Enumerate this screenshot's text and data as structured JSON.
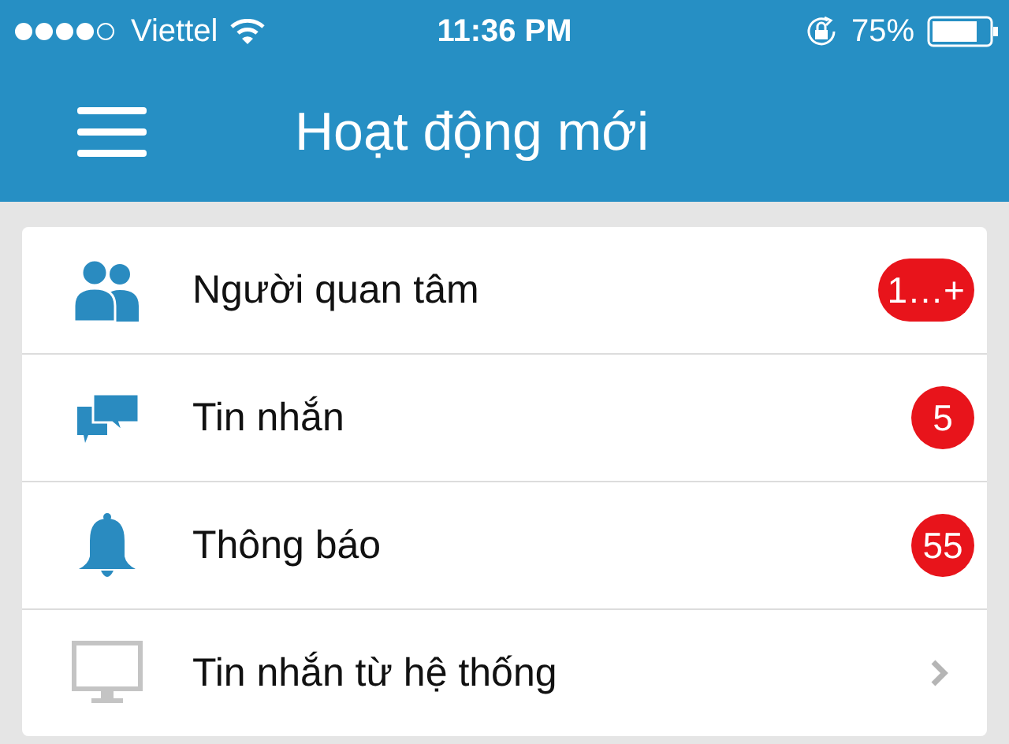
{
  "status_bar": {
    "carrier": "Viettel",
    "time": "11:36 PM",
    "battery": "75%"
  },
  "header": {
    "title": "Hoạt động mới"
  },
  "items": [
    {
      "label": "Người quan tâm",
      "kind": "badge",
      "badge": "1…+"
    },
    {
      "label": "Tin nhắn",
      "kind": "badge",
      "badge": "5"
    },
    {
      "label": "Thông báo",
      "kind": "badge",
      "badge": "55"
    },
    {
      "label": "Tin nhắn từ hệ thống",
      "kind": "link"
    }
  ]
}
